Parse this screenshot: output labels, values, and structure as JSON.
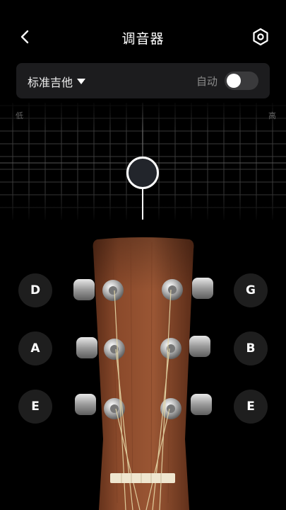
{
  "header": {
    "title": "调音器"
  },
  "selector": {
    "tuning_label": "标准吉他",
    "auto_label": "自动",
    "auto_enabled": false
  },
  "meter": {
    "low_label": "低",
    "high_label": "高"
  },
  "strings": {
    "left": [
      "D",
      "A",
      "E"
    ],
    "right": [
      "G",
      "B",
      "E"
    ]
  },
  "colors": {
    "background": "#000000",
    "panel": "#1c1c1e",
    "note_bg": "#1e1e1e",
    "headstock": "#8a4a2c"
  }
}
